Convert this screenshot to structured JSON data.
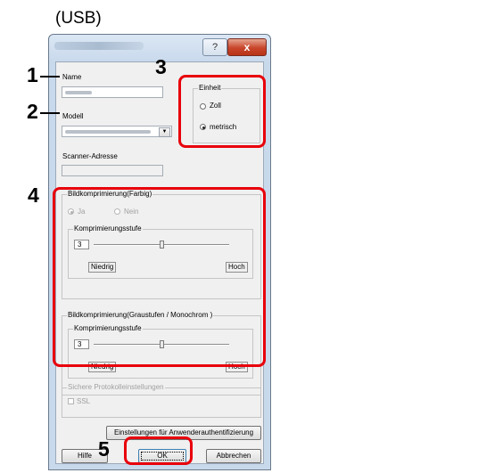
{
  "heading": "(USB)",
  "window": {
    "help_glyph": "?",
    "close_glyph": "x"
  },
  "fields": {
    "name_label": "Name",
    "model_label": "Modell",
    "scanner_address_label": "Scanner-Adresse"
  },
  "einheit": {
    "title": "Einheit",
    "options": [
      "Zoll",
      "metrisch"
    ],
    "selected": "metrisch"
  },
  "color_compression": {
    "title": "Bildkomprimierung(Farbig)",
    "options": [
      "Ja",
      "Nein"
    ],
    "selected": "Ja",
    "level_title": "Komprimierungsstufe",
    "level_value": "3",
    "low_label": "Niedrig",
    "high_label": "Hoch",
    "slider_position": 0.5
  },
  "gray_compression": {
    "title": "Bildkomprimierung(Graustufen / Monochrom )",
    "level_title": "Komprimierungsstufe",
    "level_value": "3",
    "low_label": "Niedrig",
    "high_label": "Hoch",
    "slider_position": 0.5
  },
  "secure_protocol": {
    "title": "Sichere Protokolleinstellungen",
    "ssl_label": "SSL"
  },
  "buttons": {
    "user_auth": "Einstellungen für Anwenderauthentifizierung",
    "help": "Hilfe",
    "ok": "OK",
    "cancel": "Abbrechen"
  },
  "callouts": [
    "1",
    "2",
    "3",
    "4",
    "5"
  ],
  "colors": {
    "callout_red": "#e8000b",
    "dialog_face": "#f0f0f0",
    "close_button": "#c8452b"
  }
}
